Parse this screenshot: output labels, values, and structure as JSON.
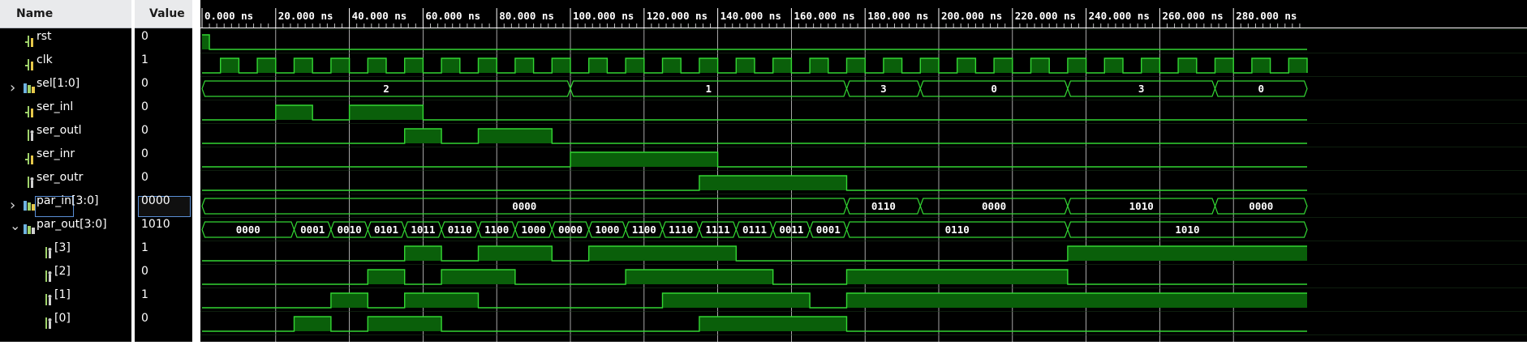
{
  "header": {
    "name_label": "Name",
    "value_label": "Value"
  },
  "colors": {
    "wave": "#33d633",
    "fill": "#0a5f0a",
    "bg": "#000000"
  },
  "timeline": {
    "unit": "ns",
    "ticks": [
      "0.000 ns",
      "20.000 ns",
      "40.000 ns",
      "60.000 ns",
      "80.000 ns",
      "100.000 ns",
      "120.000 ns",
      "140.000 ns",
      "160.000 ns",
      "180.000 ns",
      "200.000 ns",
      "220.000 ns",
      "240.000 ns",
      "260.000 ns",
      "280.000 ns"
    ],
    "visible_range_ns": [
      0,
      300
    ]
  },
  "signals": [
    {
      "name": "rst",
      "value": "0",
      "icon": "bit-input-icon",
      "expandable": false,
      "type": "bit",
      "transitions": [
        [
          0,
          1
        ],
        [
          2,
          0
        ]
      ]
    },
    {
      "name": "clk",
      "value": "1",
      "icon": "bit-input-icon",
      "expandable": false,
      "type": "clock",
      "period_ns": 10,
      "first_rise_ns": 5
    },
    {
      "name": "sel[1:0]",
      "value": "0",
      "icon": "bus-input-icon",
      "expandable": true,
      "expanded": false,
      "type": "bus",
      "segments": [
        [
          0,
          100,
          "2"
        ],
        [
          100,
          175,
          "1"
        ],
        [
          175,
          195,
          "3"
        ],
        [
          195,
          235,
          "0"
        ],
        [
          235,
          275,
          "3"
        ],
        [
          275,
          300,
          "0"
        ]
      ]
    },
    {
      "name": "ser_inl",
      "value": "0",
      "icon": "bit-input-icon",
      "expandable": false,
      "type": "bit",
      "transitions": [
        [
          0,
          0
        ],
        [
          20,
          1
        ],
        [
          30,
          0
        ],
        [
          40,
          1
        ],
        [
          60,
          0
        ]
      ]
    },
    {
      "name": "ser_outl",
      "value": "0",
      "icon": "bit-output-icon",
      "expandable": false,
      "type": "bit",
      "transitions": [
        [
          0,
          0
        ],
        [
          55,
          1
        ],
        [
          65,
          0
        ],
        [
          75,
          1
        ],
        [
          95,
          0
        ]
      ]
    },
    {
      "name": "ser_inr",
      "value": "0",
      "icon": "bit-input-icon",
      "expandable": false,
      "type": "bit",
      "transitions": [
        [
          0,
          0
        ],
        [
          100,
          1
        ],
        [
          140,
          0
        ]
      ]
    },
    {
      "name": "ser_outr",
      "value": "0",
      "icon": "bit-output-icon",
      "expandable": false,
      "type": "bit",
      "transitions": [
        [
          0,
          0
        ],
        [
          135,
          1
        ],
        [
          175,
          0
        ]
      ]
    },
    {
      "name": "par_in[3:0]",
      "value": "0000",
      "icon": "bus-input-icon",
      "expandable": true,
      "expanded": false,
      "selected": true,
      "type": "bus",
      "segments": [
        [
          0,
          175,
          "0000"
        ],
        [
          175,
          195,
          "0110"
        ],
        [
          195,
          235,
          "0000"
        ],
        [
          235,
          275,
          "1010"
        ],
        [
          275,
          300,
          "0000"
        ]
      ]
    },
    {
      "name": "par_out[3:0]",
      "value": "1010",
      "icon": "bus-output-icon",
      "expandable": true,
      "expanded": true,
      "type": "bus",
      "segments": [
        [
          0,
          25,
          "0000"
        ],
        [
          25,
          35,
          "0001"
        ],
        [
          35,
          45,
          "0010"
        ],
        [
          45,
          55,
          "0101"
        ],
        [
          55,
          65,
          "1011"
        ],
        [
          65,
          75,
          "0110"
        ],
        [
          75,
          85,
          "1100"
        ],
        [
          85,
          95,
          "1000"
        ],
        [
          95,
          105,
          "0000"
        ],
        [
          105,
          115,
          "1000"
        ],
        [
          115,
          125,
          "1100"
        ],
        [
          125,
          135,
          "1110"
        ],
        [
          135,
          145,
          "1111"
        ],
        [
          145,
          155,
          "0111"
        ],
        [
          155,
          165,
          "0011"
        ],
        [
          165,
          175,
          "0001"
        ],
        [
          175,
          235,
          "0110"
        ],
        [
          235,
          300,
          "1010"
        ]
      ]
    },
    {
      "name": "[3]",
      "value": "1",
      "icon": "bit-output-icon",
      "expandable": false,
      "child": true,
      "type": "bit",
      "transitions": [
        [
          0,
          0
        ],
        [
          55,
          1
        ],
        [
          65,
          0
        ],
        [
          75,
          1
        ],
        [
          95,
          0
        ],
        [
          105,
          1
        ],
        [
          145,
          0
        ],
        [
          235,
          1
        ]
      ]
    },
    {
      "name": "[2]",
      "value": "0",
      "icon": "bit-output-icon",
      "expandable": false,
      "child": true,
      "type": "bit",
      "transitions": [
        [
          0,
          0
        ],
        [
          45,
          1
        ],
        [
          55,
          0
        ],
        [
          65,
          1
        ],
        [
          85,
          0
        ],
        [
          115,
          1
        ],
        [
          155,
          0
        ],
        [
          175,
          1
        ],
        [
          235,
          0
        ]
      ]
    },
    {
      "name": "[1]",
      "value": "1",
      "icon": "bit-output-icon",
      "expandable": false,
      "child": true,
      "type": "bit",
      "transitions": [
        [
          0,
          0
        ],
        [
          35,
          1
        ],
        [
          45,
          0
        ],
        [
          55,
          1
        ],
        [
          75,
          0
        ],
        [
          125,
          1
        ],
        [
          165,
          0
        ],
        [
          175,
          1
        ]
      ]
    },
    {
      "name": "[0]",
      "value": "0",
      "icon": "bit-output-icon",
      "expandable": false,
      "child": true,
      "type": "bit",
      "transitions": [
        [
          0,
          0
        ],
        [
          25,
          1
        ],
        [
          35,
          0
        ],
        [
          45,
          1
        ],
        [
          65,
          0
        ],
        [
          135,
          1
        ],
        [
          175,
          0
        ]
      ]
    }
  ]
}
